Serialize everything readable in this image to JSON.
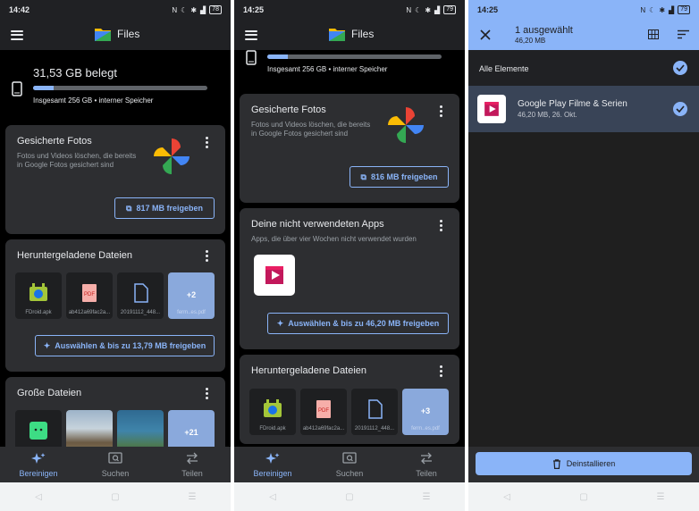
{
  "screens": [
    {
      "status": {
        "time": "14:42",
        "battery": "78"
      },
      "app_title": "Files",
      "storage": {
        "used": "31,53 GB belegt",
        "total": "Insgesamt 256 GB • interner Speicher",
        "fill_fraction": 0.12
      },
      "photos_card": {
        "title": "Gesicherte Fotos",
        "description": "Fotos und Videos löschen, die bereits in Google Fotos gesichert sind",
        "button": "817 MB freigeben"
      },
      "downloads_card": {
        "title": "Heruntergeladene Dateien",
        "files": [
          "FDroid.apk",
          "ab412a69fac2a...",
          "20191112_448..."
        ],
        "more": {
          "count": "+2",
          "name": "ferm..es.pdf"
        },
        "button": "Auswählen & bis zu 13,79 MB freigeben"
      },
      "large_card": {
        "title": "Große Dateien",
        "more_count": "+21"
      },
      "nav": [
        "Bereinigen",
        "Suchen",
        "Teilen"
      ]
    },
    {
      "status": {
        "time": "14:25",
        "battery": "79"
      },
      "app_title": "Files",
      "storage": {
        "total": "Insgesamt 256 GB • interner Speicher",
        "fill_fraction": 0.12
      },
      "photos_card": {
        "title": "Gesicherte Fotos",
        "description": "Fotos und Videos löschen, die bereits in Google Fotos gesichert sind",
        "button": "816 MB freigeben"
      },
      "apps_card": {
        "title": "Deine nicht verwendeten Apps",
        "description": "Apps, die über vier Wochen nicht verwendet wurden",
        "button": "Auswählen & bis zu 46,20 MB freigeben"
      },
      "downloads_card": {
        "title": "Heruntergeladene Dateien",
        "files": [
          "FDroid.apk",
          "ab412a69fac2a...",
          "20191112_448..."
        ],
        "more": {
          "count": "+3",
          "name": "ferm..es.pdf"
        }
      },
      "nav": [
        "Bereinigen",
        "Suchen",
        "Teilen"
      ]
    },
    {
      "status": {
        "time": "14:25",
        "battery": "79"
      },
      "selection": {
        "title": "1 ausgewählt",
        "size": "46,20 MB"
      },
      "all_items": "Alle Elemente",
      "app": {
        "name": "Google Play Filme & Serien",
        "meta": "46,20 MB, 26. Okt."
      },
      "uninstall": "Deinstallieren"
    }
  ],
  "colors": {
    "accent": "#8ab4f8",
    "card": "#2d2e31",
    "background": "#000000",
    "selected_row": "#394457"
  }
}
